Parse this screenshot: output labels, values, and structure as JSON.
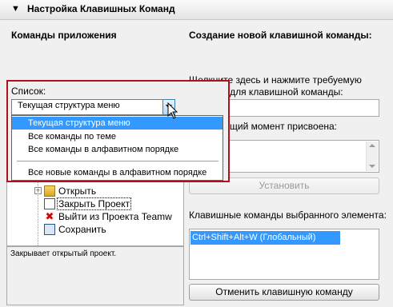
{
  "header": {
    "title": "Настройка Клавишных Команд"
  },
  "left": {
    "title": "Команды приложения",
    "list_label": "Список:",
    "combo_value": "Текущая структура меню",
    "dropdown_options": [
      "Текущая структура меню",
      "Все команды по теме",
      "Все команды в алфавитном порядке",
      "Все новые команды в алфавитном порядке"
    ],
    "tree_items": [
      "Открыть",
      "Закрыть Проект",
      "Выйти из Проекта Teamw",
      "Сохранить"
    ],
    "description": "Закрывает открытый проект."
  },
  "right": {
    "title": "Создание новой клавишной команды:",
    "instruction_line1": "Щелкните здесь и нажмите требуемую",
    "instruction_line2": "клавишу для клавишной команды:",
    "assigned_label": "щий момент присвоена:",
    "set_button": "Установить",
    "selected_label": "Клавишные команды выбранного элемента:",
    "shortcut": "Ctrl+Shift+Alt+W (Глобальный)",
    "cancel_button": "Отменить клавишную команду"
  }
}
